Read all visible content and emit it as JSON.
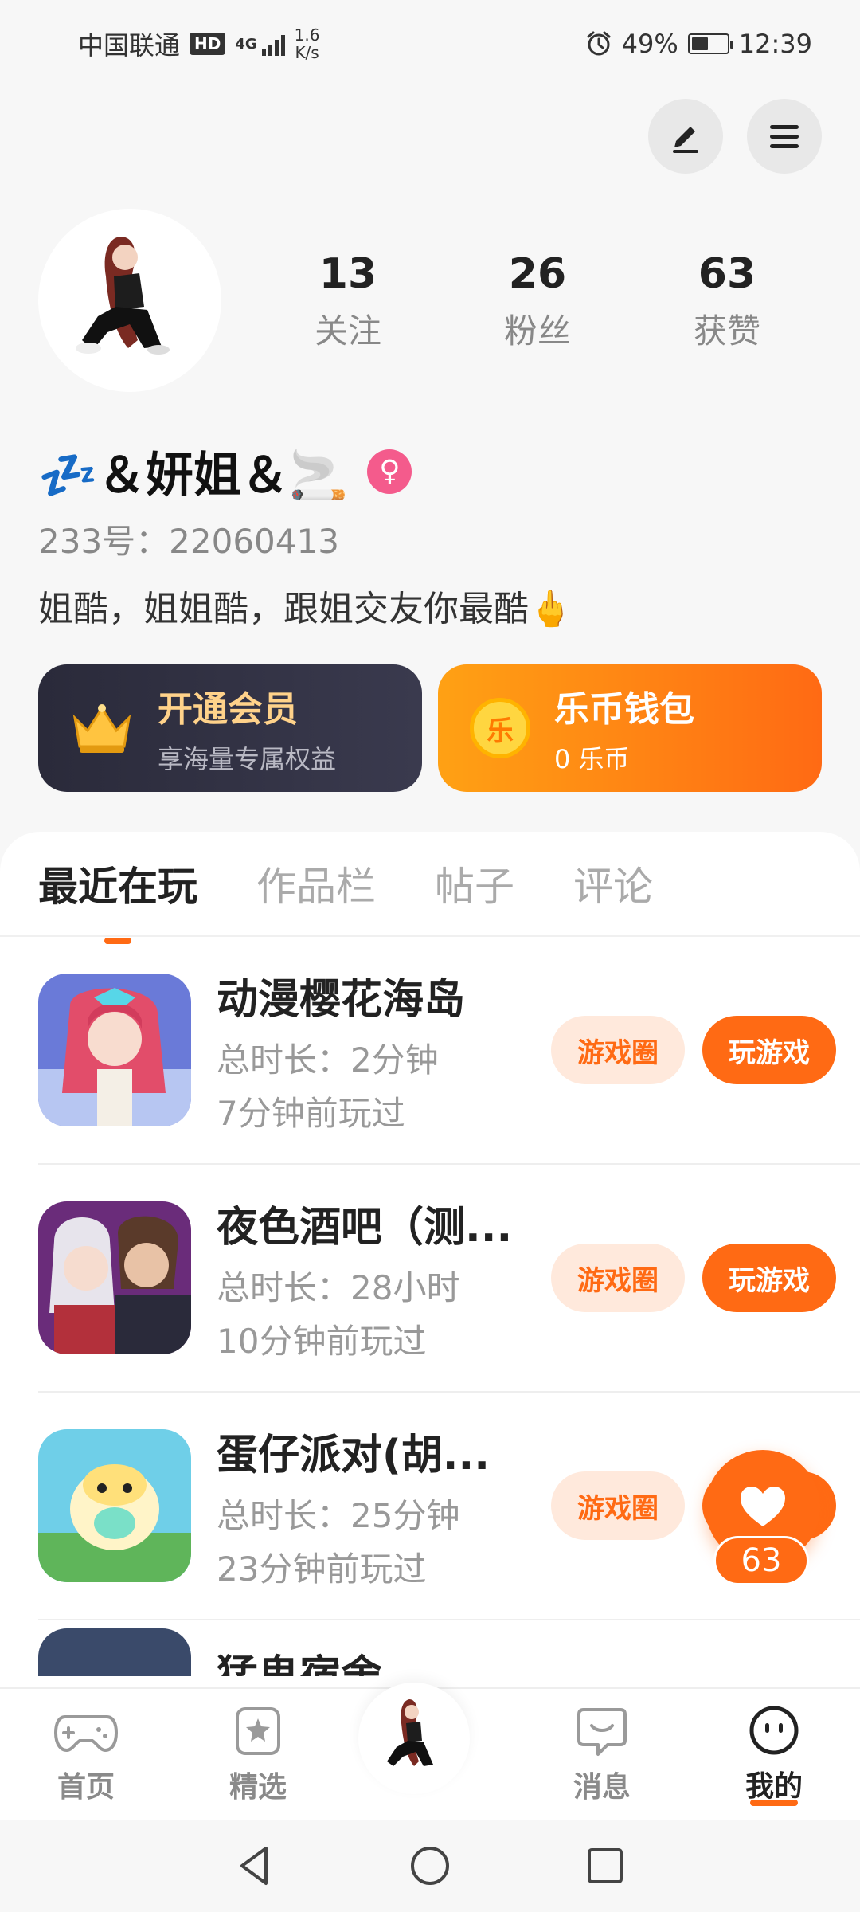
{
  "status_bar": {
    "carrier": "中国联通",
    "hd": "HD",
    "network": "4G",
    "speed_value": "1.6",
    "speed_unit": "K/s",
    "battery": "49%",
    "time": "12:39"
  },
  "profile": {
    "stats": [
      {
        "num": "13",
        "label": "关注"
      },
      {
        "num": "26",
        "label": "粉丝"
      },
      {
        "num": "63",
        "label": "获赞"
      }
    ],
    "nickname": "💤＆妍姐＆🚬",
    "gender_symbol": "♀",
    "uid": "233号：22060413",
    "bio": "姐酷，姐姐酷，跟姐交友你最酷🖕"
  },
  "cards": {
    "vip": {
      "title": "开通会员",
      "subtitle": "享海量专属权益"
    },
    "wallet": {
      "title": "乐币钱包",
      "subtitle": "0 乐币",
      "coin_char": "乐"
    }
  },
  "tabs": [
    "最近在玩",
    "作品栏",
    "帖子",
    "评论"
  ],
  "games": [
    {
      "name": "动漫樱花海岛",
      "duration": "总时长：2分钟",
      "last_played": "7分钟前玩过",
      "circle_label": "游戏圈",
      "play_label": "玩游戏"
    },
    {
      "name": "夜色酒吧（测...",
      "duration": "总时长：28小时",
      "last_played": "10分钟前玩过",
      "circle_label": "游戏圈",
      "play_label": "玩游戏"
    },
    {
      "name": "蛋仔派对(胡...",
      "duration": "总时长：25分钟",
      "last_played": "23分钟前玩过",
      "circle_label": "游戏圈",
      "play_label": ""
    }
  ],
  "partial_game_name": "猛鬼宿舍",
  "float_like": {
    "count": "63"
  },
  "bottom_nav": [
    {
      "label": "首页"
    },
    {
      "label": "精选"
    },
    {
      "label": ""
    },
    {
      "label": "消息"
    },
    {
      "label": "我的"
    }
  ],
  "colors": {
    "accent": "#ff6a14",
    "vip_dark": "#2a2a3a",
    "gold": "#ffd28a"
  }
}
